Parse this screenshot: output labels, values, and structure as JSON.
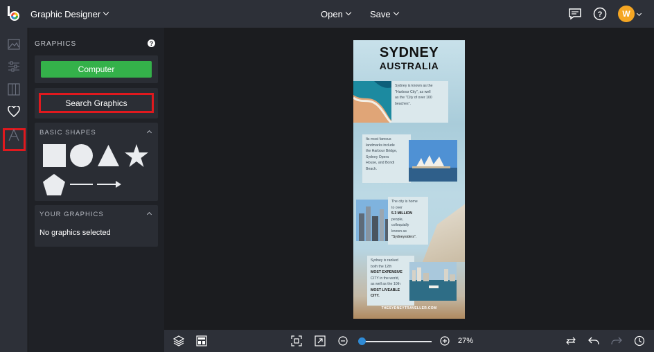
{
  "app": {
    "title": "Graphic Designer",
    "menu_open": "Open",
    "menu_save": "Save",
    "user_initial": "W"
  },
  "panel": {
    "heading": "GRAPHICS",
    "help": "?",
    "computer_button": "Computer",
    "search_button": "Search Graphics",
    "basic_shapes_title": "BASIC SHAPES",
    "your_graphics_title": "YOUR GRAPHICS",
    "no_graphics": "No graphics selected"
  },
  "rail": {
    "items": [
      "image-icon",
      "sliders-icon",
      "layout-columns-icon",
      "heart-icon",
      "text-icon"
    ],
    "active": "heart-icon"
  },
  "shapes": [
    "square",
    "circle",
    "triangle",
    "star",
    "pentagon",
    "line",
    "arrow"
  ],
  "poster": {
    "title_line1": "SYDNEY",
    "title_line2": "AUSTRALIA",
    "box1": [
      "Sydney is known as the",
      "\"Harbour City\", as well",
      "as the \"City of over 100",
      "beaches\"."
    ],
    "box2": [
      "Its most famous",
      "landmarks include",
      "the Harbour Bridge,",
      "Sydney Opera",
      "House, and Bondi",
      "Beach."
    ],
    "box3": [
      "The city is home",
      "to over",
      "5.3 MILLION",
      "people,",
      "colloquially",
      "known as",
      "\"Sydneysiders\"."
    ],
    "box4": [
      "Sydney is ranked",
      "both the 12th",
      "MOST EXPENSIVE",
      "CITY in the world,",
      "as well as the 10th",
      "MOST LIVEABLE",
      "CITY."
    ],
    "footer": "THESYDNEYTRAVELLER.COM"
  },
  "bottom": {
    "zoom_level": "27%",
    "zoom_fraction": 0.0
  },
  "colors": {
    "accent_green": "#34b14a",
    "highlight_red": "#e0191e",
    "avatar_orange": "#f5a623",
    "zoom_blue": "#2f8bd6"
  }
}
